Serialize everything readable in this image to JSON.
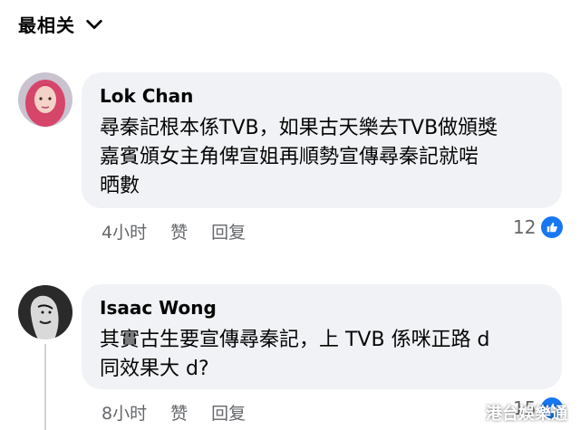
{
  "sort": {
    "label": "最相关"
  },
  "comments": [
    {
      "author": "Lok Chan",
      "text": "尋秦記根本係TVB，如果古天樂去TVB做頒獎\n嘉賓頒女主角俾宣姐再順勢宣傳尋秦記就啱\n晒數",
      "time": "4小时",
      "like_label": "赞",
      "reply_label": "回复",
      "reaction_count": "12",
      "avatar_icon": "person-red-hair-avatar"
    },
    {
      "author": "Isaac Wong",
      "text": "其實古生要宣傳尋秦記，上 TVB 係咪正路 d\n同效果大 d?",
      "time": "8小时",
      "like_label": "赞",
      "reply_label": "回复",
      "reaction_count": "15",
      "avatar_icon": "monochrome-face-avatar"
    }
  ],
  "watermark": "港台娛樂通",
  "colors": {
    "bubble": "#f0f2f5",
    "like_blue": "#1877f2",
    "meta": "#65676b"
  }
}
